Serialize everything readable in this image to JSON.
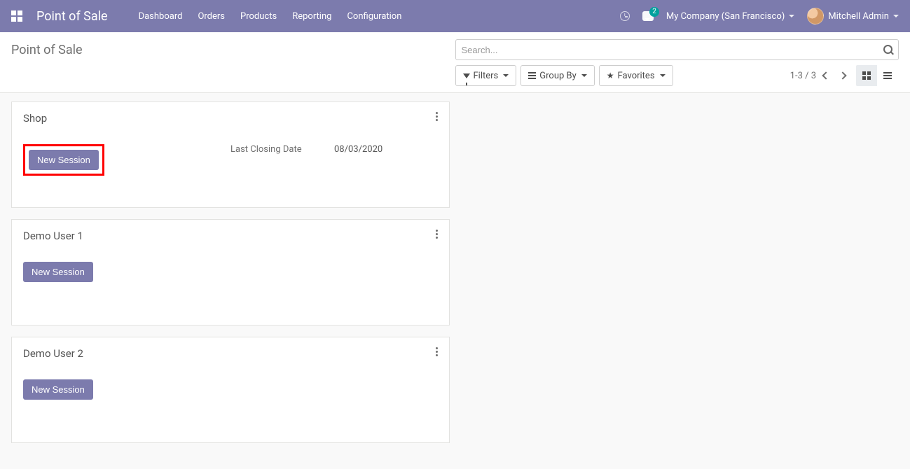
{
  "navbar": {
    "brand": "Point of Sale",
    "links": [
      "Dashboard",
      "Orders",
      "Products",
      "Reporting",
      "Configuration"
    ],
    "chat_badge": "2",
    "company": "My Company (San Francisco)",
    "user": "Mitchell Admin"
  },
  "control": {
    "title": "Point of Sale",
    "search_placeholder": "Search...",
    "filters_label": "Filters",
    "groupby_label": "Group By",
    "favorites_label": "Favorites",
    "pager": "1-3 / 3"
  },
  "cards": [
    {
      "title": "Shop",
      "button": "New Session",
      "info_label": "Last Closing Date",
      "info_value": "08/03/2020",
      "highlighted": true
    },
    {
      "title": "Demo User 1",
      "button": "New Session",
      "info_label": "",
      "info_value": "",
      "highlighted": false
    },
    {
      "title": "Demo User 2",
      "button": "New Session",
      "info_label": "",
      "info_value": "",
      "highlighted": false
    }
  ]
}
